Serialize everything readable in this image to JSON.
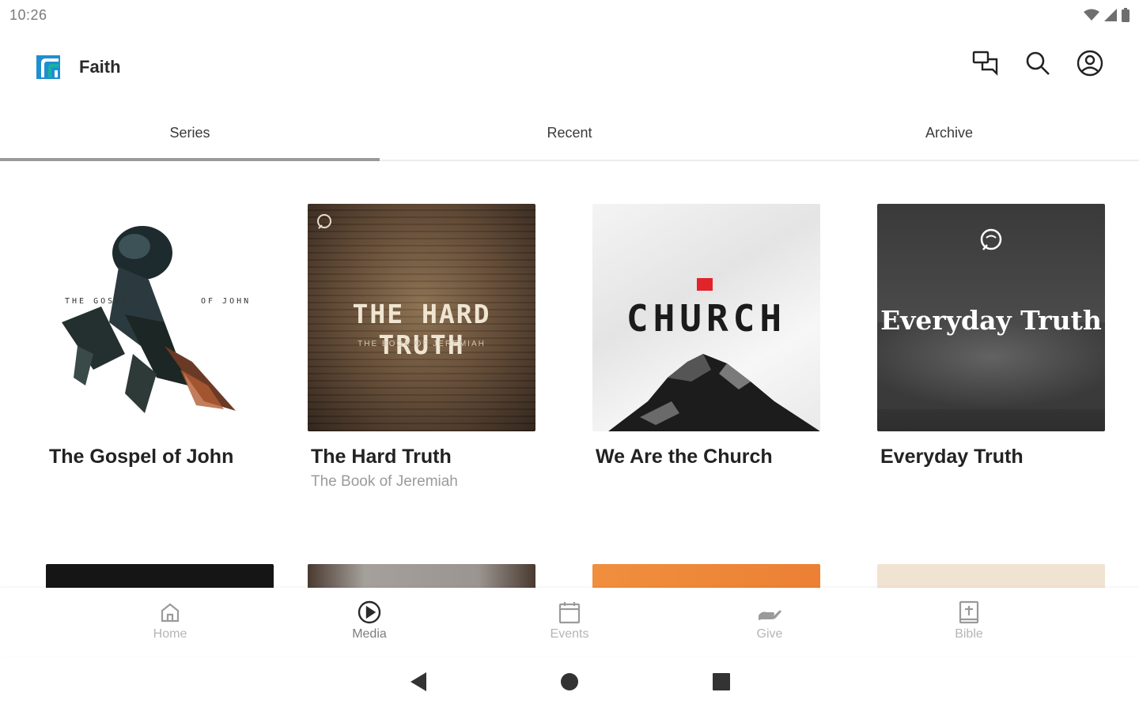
{
  "status_bar": {
    "time": "10:26"
  },
  "app_bar": {
    "title": "Faith"
  },
  "tabs": [
    {
      "label": "Series",
      "active": true
    },
    {
      "label": "Recent",
      "active": false
    },
    {
      "label": "Archive",
      "active": false
    }
  ],
  "series": [
    {
      "title": "The Gospel of John",
      "subtitle": "",
      "art_text_left": "THE GOSPEL",
      "art_text_right": "OF JOHN"
    },
    {
      "title": "The Hard Truth",
      "subtitle": "The Book of Jeremiah",
      "art_title": "THE HARD TRUTH",
      "art_sub": "THE BOOK OF JEREMIAH"
    },
    {
      "title": "We Are the Church",
      "subtitle": "",
      "art_title": "CHURCH"
    },
    {
      "title": "Everyday Truth",
      "subtitle": "",
      "art_title": "Everyday Truth"
    }
  ],
  "second_row_colors": [
    "#151515",
    "#8f8a86",
    "#ee8a3e",
    "#f1e3d2"
  ],
  "bottom_nav": [
    {
      "label": "Home",
      "icon": "home-icon",
      "active": false
    },
    {
      "label": "Media",
      "icon": "play-circle-icon",
      "active": true
    },
    {
      "label": "Events",
      "icon": "calendar-icon",
      "active": false
    },
    {
      "label": "Give",
      "icon": "give-icon",
      "active": false
    },
    {
      "label": "Bible",
      "icon": "bible-icon",
      "active": false
    }
  ],
  "colors": {
    "tab_indicator": "#9a9a9a",
    "logo_blue": "#1f8fd0",
    "logo_teal": "#17b1a5"
  }
}
